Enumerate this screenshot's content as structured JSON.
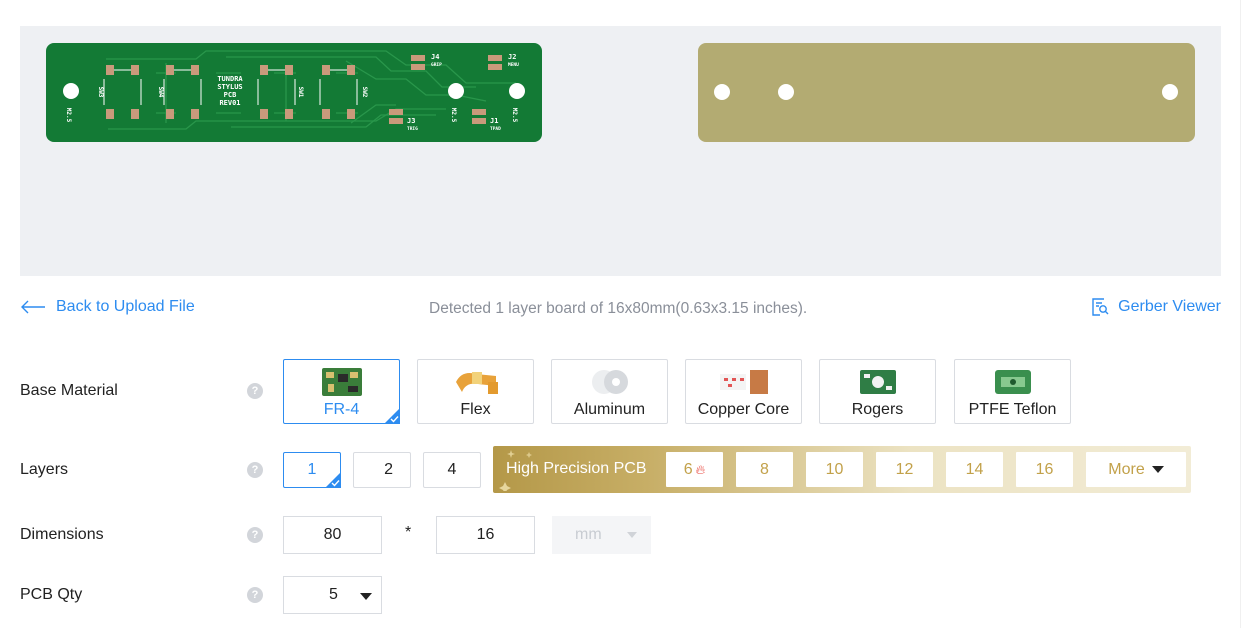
{
  "preview": {
    "front_silkscreen": {
      "board_title": [
        "TUNDRA",
        "STYLUS",
        "PCB",
        "REV01"
      ],
      "switch_labels": [
        "SW3",
        "SW4",
        "SW1",
        "SW2"
      ],
      "connectors": [
        {
          "ref": "J4",
          "name": "GRIP"
        },
        {
          "ref": "J2",
          "name": "MENU"
        },
        {
          "ref": "J3",
          "name": "TRIG"
        },
        {
          "ref": "J1",
          "name": "TPAD"
        }
      ],
      "mount_labels": [
        "M2.5",
        "M2.5",
        "M2.5"
      ]
    },
    "colors": {
      "panel_bg": "#eef0f3",
      "board_green": "#137a35",
      "copper_pad": "#c99a7b",
      "back_board": "#b3ab72"
    }
  },
  "info_bar": {
    "back_label": "Back to Upload File",
    "detected_text": "Detected 1 layer board of 16x80mm(0.63x3.15 inches).",
    "gerber_label": "Gerber Viewer"
  },
  "base_material": {
    "label": "Base Material",
    "help": "?",
    "options": [
      {
        "label": "FR-4",
        "selected": true,
        "icon": "fr4-board-icon"
      },
      {
        "label": "Flex",
        "selected": false,
        "icon": "flex-board-icon"
      },
      {
        "label": "Aluminum",
        "selected": false,
        "icon": "aluminum-board-icon"
      },
      {
        "label": "Copper Core",
        "selected": false,
        "icon": "copper-core-board-icon"
      },
      {
        "label": "Rogers",
        "selected": false,
        "icon": "rogers-board-icon"
      },
      {
        "label": "PTFE Teflon",
        "selected": false,
        "icon": "ptfe-board-icon"
      }
    ]
  },
  "layers": {
    "label": "Layers",
    "help": "?",
    "options": [
      {
        "label": "1",
        "selected": true
      },
      {
        "label": "2",
        "selected": false
      },
      {
        "label": "4",
        "selected": false
      }
    ],
    "high_precision": {
      "label": "High Precision PCB",
      "options": [
        "6",
        "8",
        "10",
        "12",
        "14",
        "16"
      ],
      "hot_option": "6",
      "more_label": "More"
    }
  },
  "dimensions": {
    "label": "Dimensions",
    "help": "?",
    "length": "80",
    "separator": "*",
    "width": "16",
    "unit": "mm"
  },
  "pcb_qty": {
    "label": "PCB Qty",
    "help": "?",
    "value": "5"
  },
  "accent": {
    "blue": "#2d8cf0",
    "gold": "#c2a14a",
    "hot_red": "#e8453c"
  }
}
